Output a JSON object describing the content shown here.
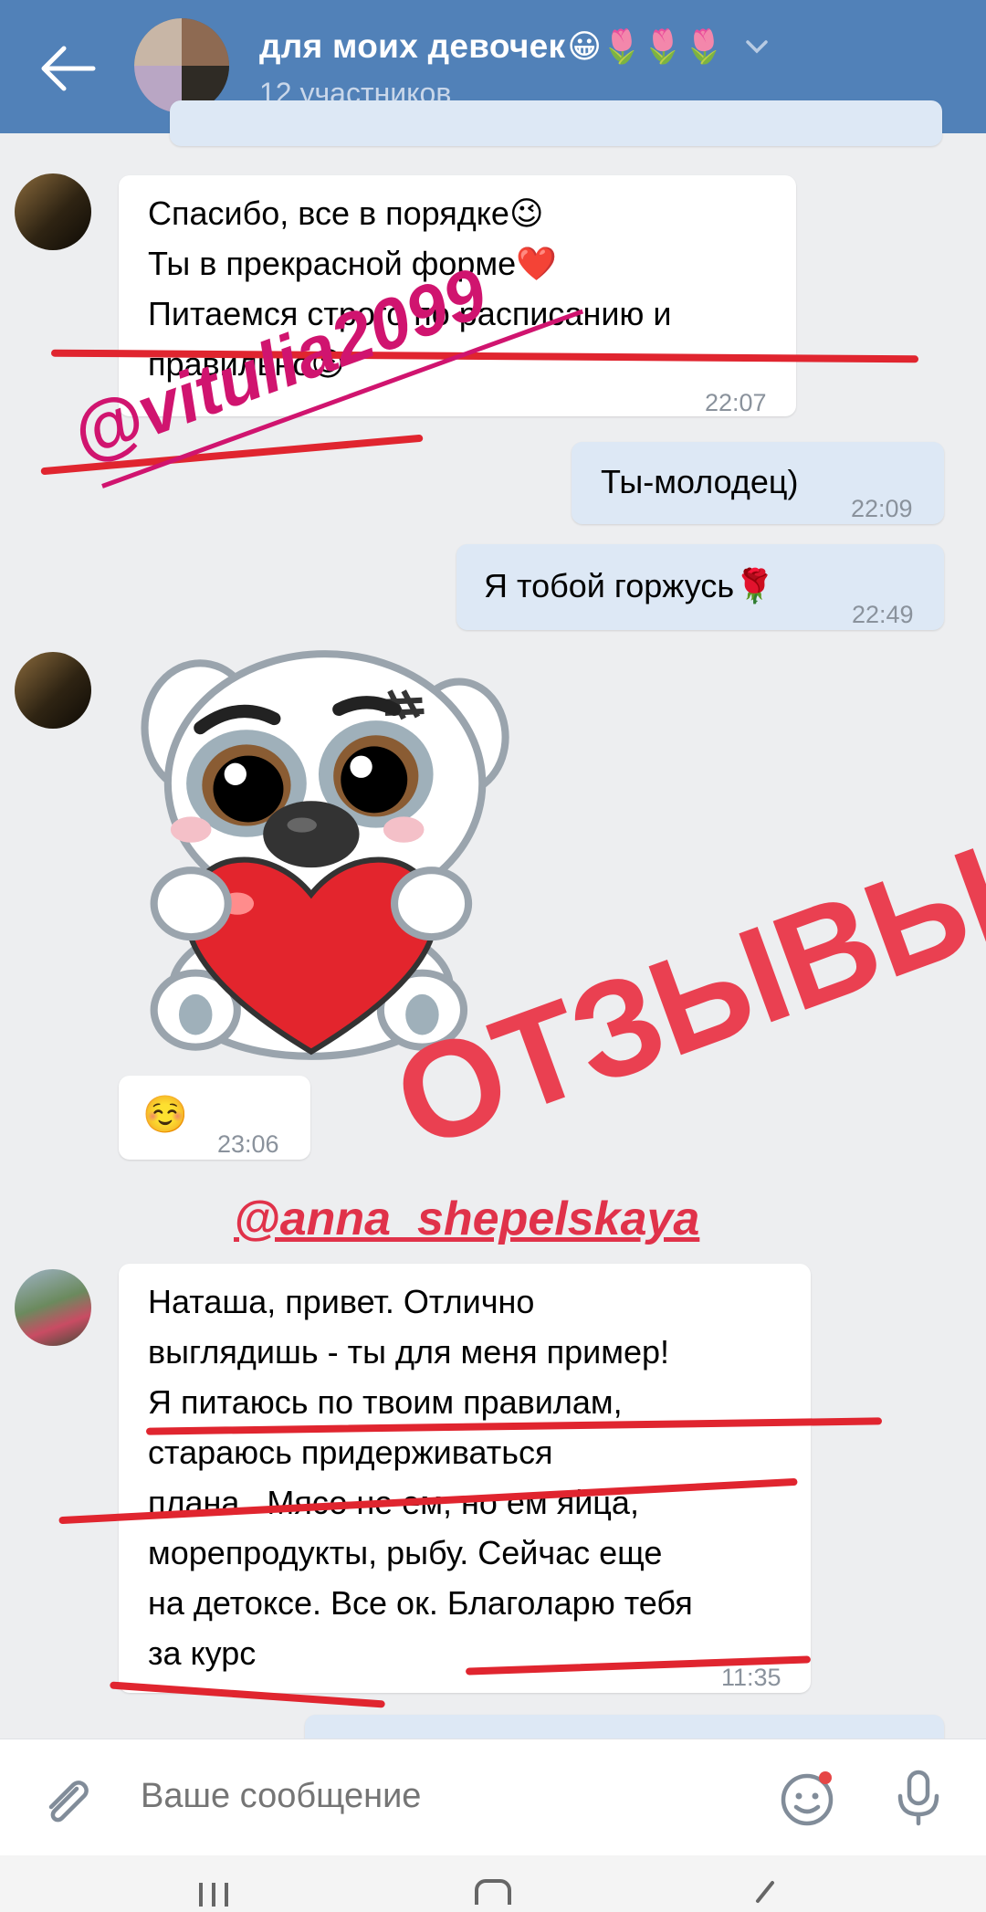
{
  "header": {
    "title": "для моих девочек",
    "title_emoji": "😀🌷🌷🌷",
    "subtitle": "12 участников"
  },
  "messages": [
    {
      "direction": "in",
      "text": "Спасибо, все в порядке😉\nТы в прекрасной форме❤️\nПитаемся строго по расписанию и\nправильно😉",
      "time": "22:07"
    },
    {
      "direction": "out",
      "text": "Ты-молодец)",
      "time": "22:09"
    },
    {
      "direction": "out",
      "text": "Я тобой горжусь🌹",
      "time": "22:49"
    },
    {
      "direction": "in",
      "sticker": "dog-with-heart-sticker",
      "time": "23:06"
    },
    {
      "direction": "in",
      "text": "☺️",
      "time": "23:06"
    },
    {
      "direction": "in",
      "text": "Наташа, привет. Отлично\nвыглядишь - ты для меня пример!\nЯ питаюсь по твоим правилам,\nстараюсь придерживаться\nплана.  Мясо не ем, но ем яйца,\nморепродукты, рыбу. Сейчас еще\nна детоксе. Все ок. Благоларю тебя\nза курс",
      "time": "11:35"
    }
  ],
  "overlays": {
    "handle1": "@vitulia2099",
    "handle2": "@anna_shepelskaya",
    "reviews_label": "ОТЗЫВЫ!"
  },
  "input": {
    "placeholder": "Ваше сообщение"
  },
  "icons": {
    "back": "arrow-left-icon",
    "dropdown": "chevron-down-icon",
    "attach": "paperclip-icon",
    "sticker": "smiley-icon",
    "mic": "microphone-icon"
  },
  "colors": {
    "header_bg": "#5181b8",
    "chat_bg": "#edeef0",
    "outgoing_bubble": "#dde8f5",
    "overlay_red": "#e0252f",
    "handle_magenta": "#d0146f",
    "reviews_red": "#ea4051"
  }
}
